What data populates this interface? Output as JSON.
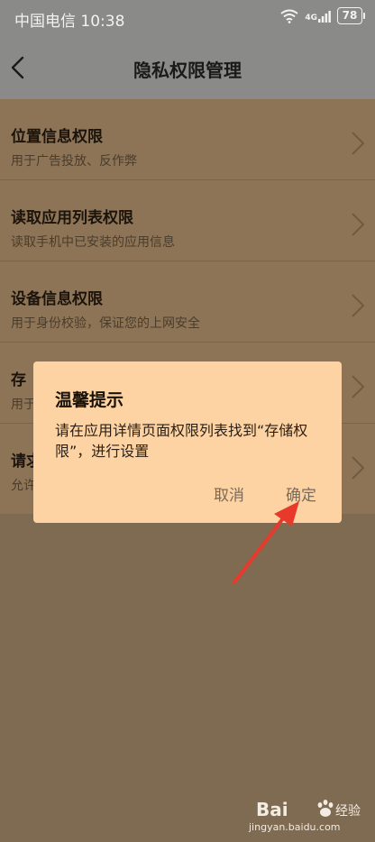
{
  "status_bar": {
    "carrier": "中国电信",
    "time": "10:38",
    "network_badge": "4G",
    "battery": "78"
  },
  "header": {
    "title": "隐私权限管理"
  },
  "permissions": [
    {
      "title": "位置信息权限",
      "desc": "用于广告投放、反作弊"
    },
    {
      "title": "读取应用列表权限",
      "desc": "读取手机中已安装的应用信息"
    },
    {
      "title": "设备信息权限",
      "desc": "用于身份校验，保证您的上网安全"
    },
    {
      "title": "存储权限",
      "desc": "用于",
      "visible_title": "存",
      "visible_desc": "用于"
    },
    {
      "title": "请求权限",
      "desc": "允许",
      "visible_title": "请求",
      "visible_desc": "允许"
    }
  ],
  "dialog": {
    "title": "温馨提示",
    "message": "请在应用详情页面权限列表找到“存储权限”，进行设置",
    "cancel_label": "取消",
    "confirm_label": "确定"
  },
  "watermark": {
    "logo": "Bai",
    "brand": "经验",
    "url": "jingyan.baidu.com"
  },
  "colors": {
    "dialog_bg": "#fed3a3",
    "overlay": "#7f6a52",
    "arrow": "#e83a2c"
  }
}
